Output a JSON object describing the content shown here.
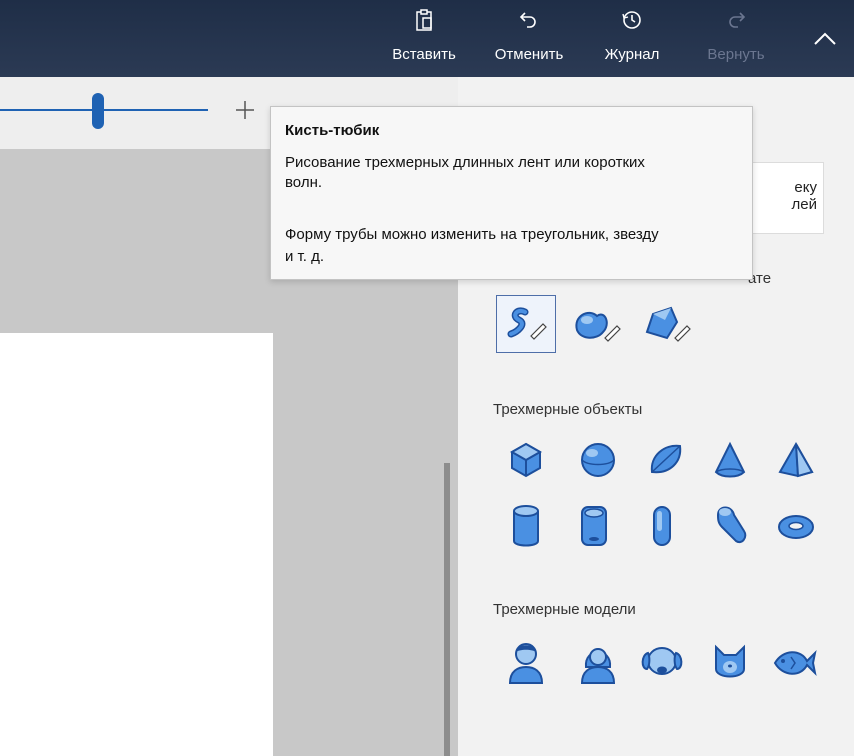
{
  "toolbar": {
    "paste_label": "Вставить",
    "undo_label": "Отменить",
    "history_label": "Журнал",
    "redo_label": "Вернуть"
  },
  "tooltip": {
    "title": "Кисть-тюбик",
    "line1": "Рисование трехмерных длинных лент или коротких",
    "line2": "волн.",
    "line3": "Форму трубы можно изменить на треугольник, звезду",
    "line4": "и т. д."
  },
  "panel": {
    "library_line1": "еку",
    "library_line2": "лей",
    "partial_heading": "ате",
    "objects_title": "Трехмерные объекты",
    "models_title": "Трехмерные модели"
  },
  "colors": {
    "accent": "#1f62b3",
    "shape_fill": "#4a90e2",
    "shape_stroke": "#1d4f9c",
    "titlebar": "#23324b"
  },
  "icons": {
    "doodle_tools": [
      "tube-brush-icon",
      "soft-edge-doodle-icon",
      "sharp-edge-doodle-icon"
    ],
    "objects": [
      "cube-icon",
      "sphere-icon",
      "hemisphere-icon",
      "cone-icon",
      "pyramid-icon",
      "cylinder-icon",
      "tube-icon",
      "capsule-icon",
      "curved-tube-icon",
      "torus-icon"
    ],
    "models": [
      "man-icon",
      "woman-icon",
      "dog-icon",
      "cat-icon",
      "fish-icon"
    ]
  }
}
